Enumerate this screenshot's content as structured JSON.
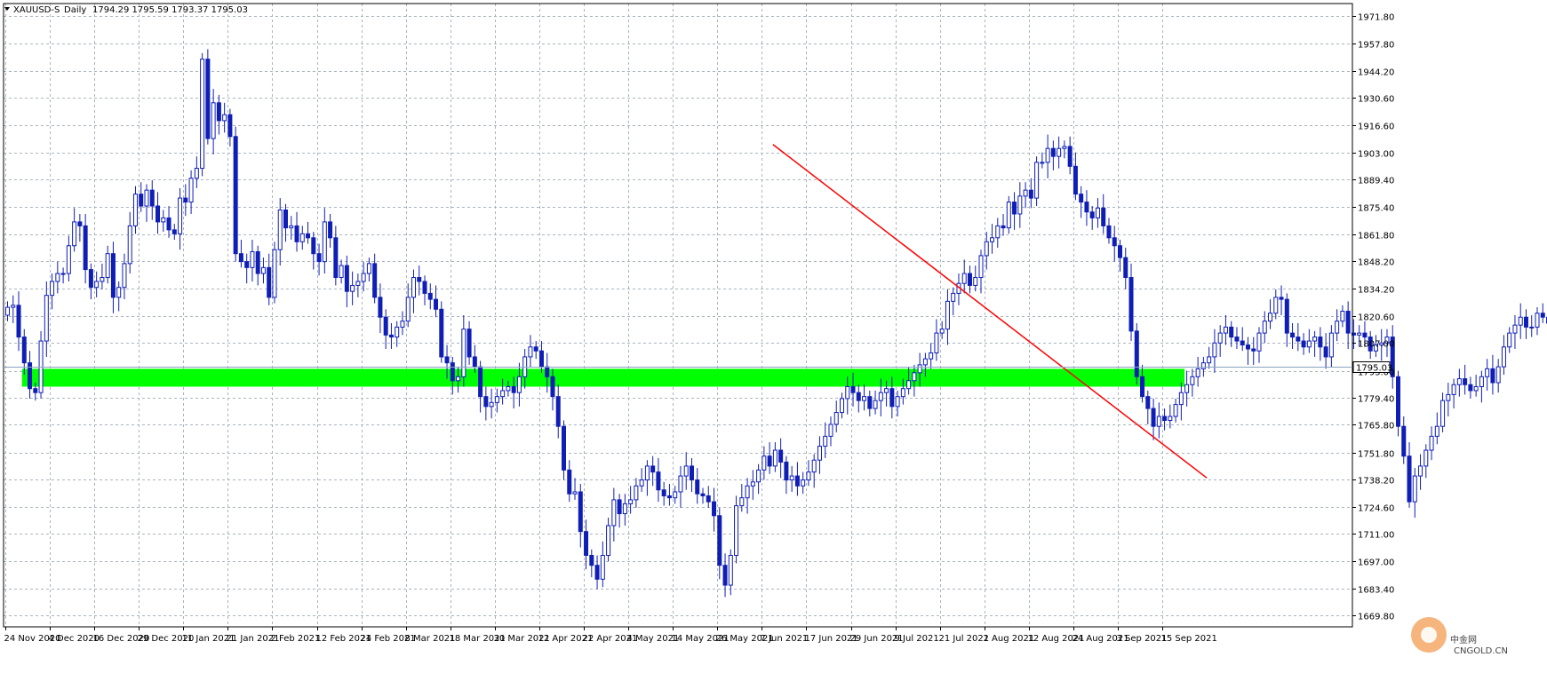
{
  "header": {
    "symbol": "XAUUSD-S",
    "timeframe": "Daily",
    "ohlc": "1794.29 1795.59 1793.37 1795.03"
  },
  "watermark": {
    "text": "中金网",
    "sub": "CNGOLD.CN"
  },
  "colors": {
    "candle": "#0f1eb4",
    "grid": "#a9b4bf",
    "zone": "#00ff00",
    "trendline": "#ff0000",
    "price_line": "#8aa4be"
  },
  "chart_data": {
    "type": "candlestick",
    "instrument": "XAUUSD-S",
    "timeframe": "Daily",
    "y_axis": {
      "range": [
        1664.0,
        1978.0
      ],
      "ticks": [
        "1971.80",
        "1957.80",
        "1944.20",
        "1930.60",
        "1916.60",
        "1903.00",
        "1889.40",
        "1875.40",
        "1861.80",
        "1848.20",
        "1834.20",
        "1820.60",
        "1807.00",
        "1793.00",
        "1779.40",
        "1765.80",
        "1751.80",
        "1738.20",
        "1724.60",
        "1711.00",
        "1697.00",
        "1683.40",
        "1669.80"
      ],
      "position": "right"
    },
    "x_axis": {
      "labels": [
        "24 Nov 2020",
        "4 Dec 2020",
        "16 Dec 2020",
        "29 Dec 2020",
        "11 Jan 2021",
        "21 Jan 2021",
        "2 Feb 2021",
        "12 Feb 2021",
        "24 Feb 2021",
        "8 Mar 2021",
        "18 Mar 2021",
        "30 Mar 2021",
        "12 Apr 2021",
        "22 Apr 2021",
        "4 May 2021",
        "14 May 2021",
        "26 May 2021",
        "7 Jun 2021",
        "17 Jun 2021",
        "29 Jun 2021",
        "9 Jul 2021",
        "21 Jul 2021",
        "2 Aug 2021",
        "12 Aug 2021",
        "24 Aug 2021",
        "3 Sep 2021",
        "15 Sep 2021"
      ],
      "label_bar_index": [
        0,
        8,
        16,
        24,
        32,
        40,
        48,
        56,
        64,
        72,
        80,
        88,
        96,
        104,
        112,
        120,
        128,
        136,
        144,
        152,
        160,
        168,
        176,
        184,
        192,
        200,
        208
      ]
    },
    "grid": true,
    "current_price": 1795.03,
    "current_price_label": "1795.03",
    "support_zone": {
      "low": 1785.0,
      "high": 1794.0,
      "from_bar": 3,
      "to_bar": 212
    },
    "trendline": {
      "from_bar": 138,
      "from_price": 1907.0,
      "to_bar": 216,
      "to_price": 1739.0
    },
    "closes": [
      1825,
      1826,
      1810,
      1797,
      1784,
      1782,
      1808,
      1831,
      1838,
      1842,
      1842,
      1856,
      1868,
      1866,
      1844,
      1835,
      1838,
      1840,
      1852,
      1830,
      1835,
      1847,
      1866,
      1882,
      1876,
      1884,
      1876,
      1868,
      1870,
      1864,
      1862,
      1880,
      1878,
      1890,
      1895,
      1950,
      1910,
      1928,
      1919,
      1922,
      1911,
      1852,
      1848,
      1845,
      1853,
      1842,
      1845,
      1830,
      1854,
      1874,
      1865,
      1866,
      1858,
      1862,
      1860,
      1852,
      1848,
      1868,
      1860,
      1840,
      1846,
      1833,
      1836,
      1838,
      1842,
      1847,
      1830,
      1820,
      1811,
      1810,
      1815,
      1818,
      1830,
      1840,
      1838,
      1832,
      1829,
      1824,
      1800,
      1797,
      1788,
      1790,
      1814,
      1800,
      1795,
      1780,
      1775,
      1777,
      1780,
      1783,
      1785,
      1782,
      1790,
      1800,
      1805,
      1803,
      1795,
      1790,
      1780,
      1765,
      1743,
      1731,
      1732,
      1712,
      1700,
      1695,
      1688,
      1700,
      1715,
      1728,
      1721,
      1726,
      1728,
      1735,
      1738,
      1745,
      1742,
      1733,
      1730,
      1729,
      1732,
      1740,
      1745,
      1738,
      1731,
      1730,
      1727,
      1720,
      1695,
      1685,
      1700,
      1725,
      1729,
      1735,
      1737,
      1743,
      1750,
      1745,
      1753,
      1747,
      1738,
      1740,
      1735,
      1738,
      1742,
      1748,
      1755,
      1760,
      1766,
      1772,
      1779,
      1785,
      1782,
      1778,
      1780,
      1774,
      1778,
      1782,
      1784,
      1775,
      1780,
      1784,
      1788,
      1792,
      1796,
      1799,
      1802,
      1812,
      1814,
      1828,
      1832,
      1837,
      1842,
      1836,
      1840,
      1851,
      1858,
      1860,
      1866,
      1865,
      1878,
      1872,
      1881,
      1884,
      1880,
      1898,
      1898,
      1905,
      1901,
      1905,
      1906,
      1896,
      1882,
      1878,
      1873,
      1870,
      1875,
      1866,
      1860,
      1856,
      1850,
      1840,
      1813,
      1790,
      1780,
      1774,
      1765,
      1770,
      1768,
      1770,
      1776,
      1782,
      1786,
      1790,
      1794,
      1797,
      1800,
      1807,
      1812,
      1815,
      1810,
      1808,
      1806,
      1804,
      1803,
      1812,
      1818,
      1822,
      1830,
      1829,
      1812,
      1810,
      1808,
      1805,
      1808,
      1810,
      1805,
      1800,
      1812,
      1818,
      1823,
      1812,
      1811,
      1812,
      1810,
      1803,
      1806,
      1807,
      1810,
      1790,
      1765,
      1750,
      1727,
      1740,
      1745,
      1753,
      1760,
      1765,
      1778,
      1781,
      1786,
      1789,
      1786,
      1783,
      1785,
      1790,
      1794,
      1787,
      1795,
      1805,
      1812,
      1816,
      1820,
      1815,
      1815,
      1822,
      1820,
      1817,
      1813,
      1811,
      1797,
      1793,
      1791,
      1794,
      1795
    ],
    "ohlc_note": "Values approximated visually from candle bodies."
  }
}
